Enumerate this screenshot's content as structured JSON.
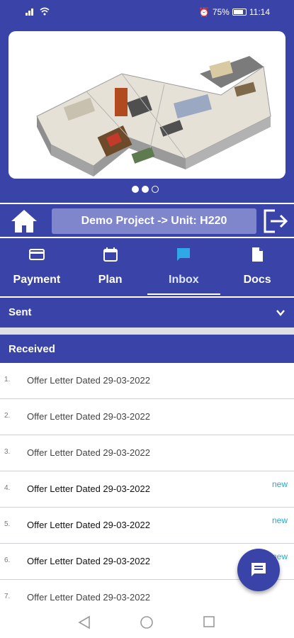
{
  "status": {
    "battery": "75%",
    "time": "11:14",
    "signal_icon": "signal-icon",
    "wifi_icon": "wifi-icon"
  },
  "carousel": {
    "pages": 3,
    "active_index": 1,
    "image": "3d-floor-plan-render"
  },
  "project": {
    "title": "Demo Project -> Unit: H220"
  },
  "tabs": [
    {
      "label": "Payment",
      "icon": "card-icon"
    },
    {
      "label": "Plan",
      "icon": "calendar-icon"
    },
    {
      "label": "Inbox",
      "icon": "message-icon",
      "active": true
    },
    {
      "label": "Docs",
      "icon": "document-icon"
    }
  ],
  "sections": {
    "sent": "Sent",
    "received": "Received"
  },
  "received_list": [
    {
      "num": "1.",
      "title": "Offer Letter Dated 29-03-2022",
      "badge": ""
    },
    {
      "num": "2.",
      "title": "Offer Letter Dated 29-03-2022",
      "badge": ""
    },
    {
      "num": "3.",
      "title": "Offer Letter Dated 29-03-2022",
      "badge": ""
    },
    {
      "num": "4.",
      "title": "Offer Letter Dated 29-03-2022",
      "badge": "new"
    },
    {
      "num": "5.",
      "title": "Offer Letter Dated 29-03-2022",
      "badge": "new"
    },
    {
      "num": "6.",
      "title": "Offer Letter Dated 29-03-2022",
      "badge": "new"
    },
    {
      "num": "7.",
      "title": "Offer Letter Dated 29-03-2022",
      "badge": ""
    }
  ],
  "colors": {
    "primary": "#3a44a8",
    "accent_new": "#2fa8c4"
  }
}
